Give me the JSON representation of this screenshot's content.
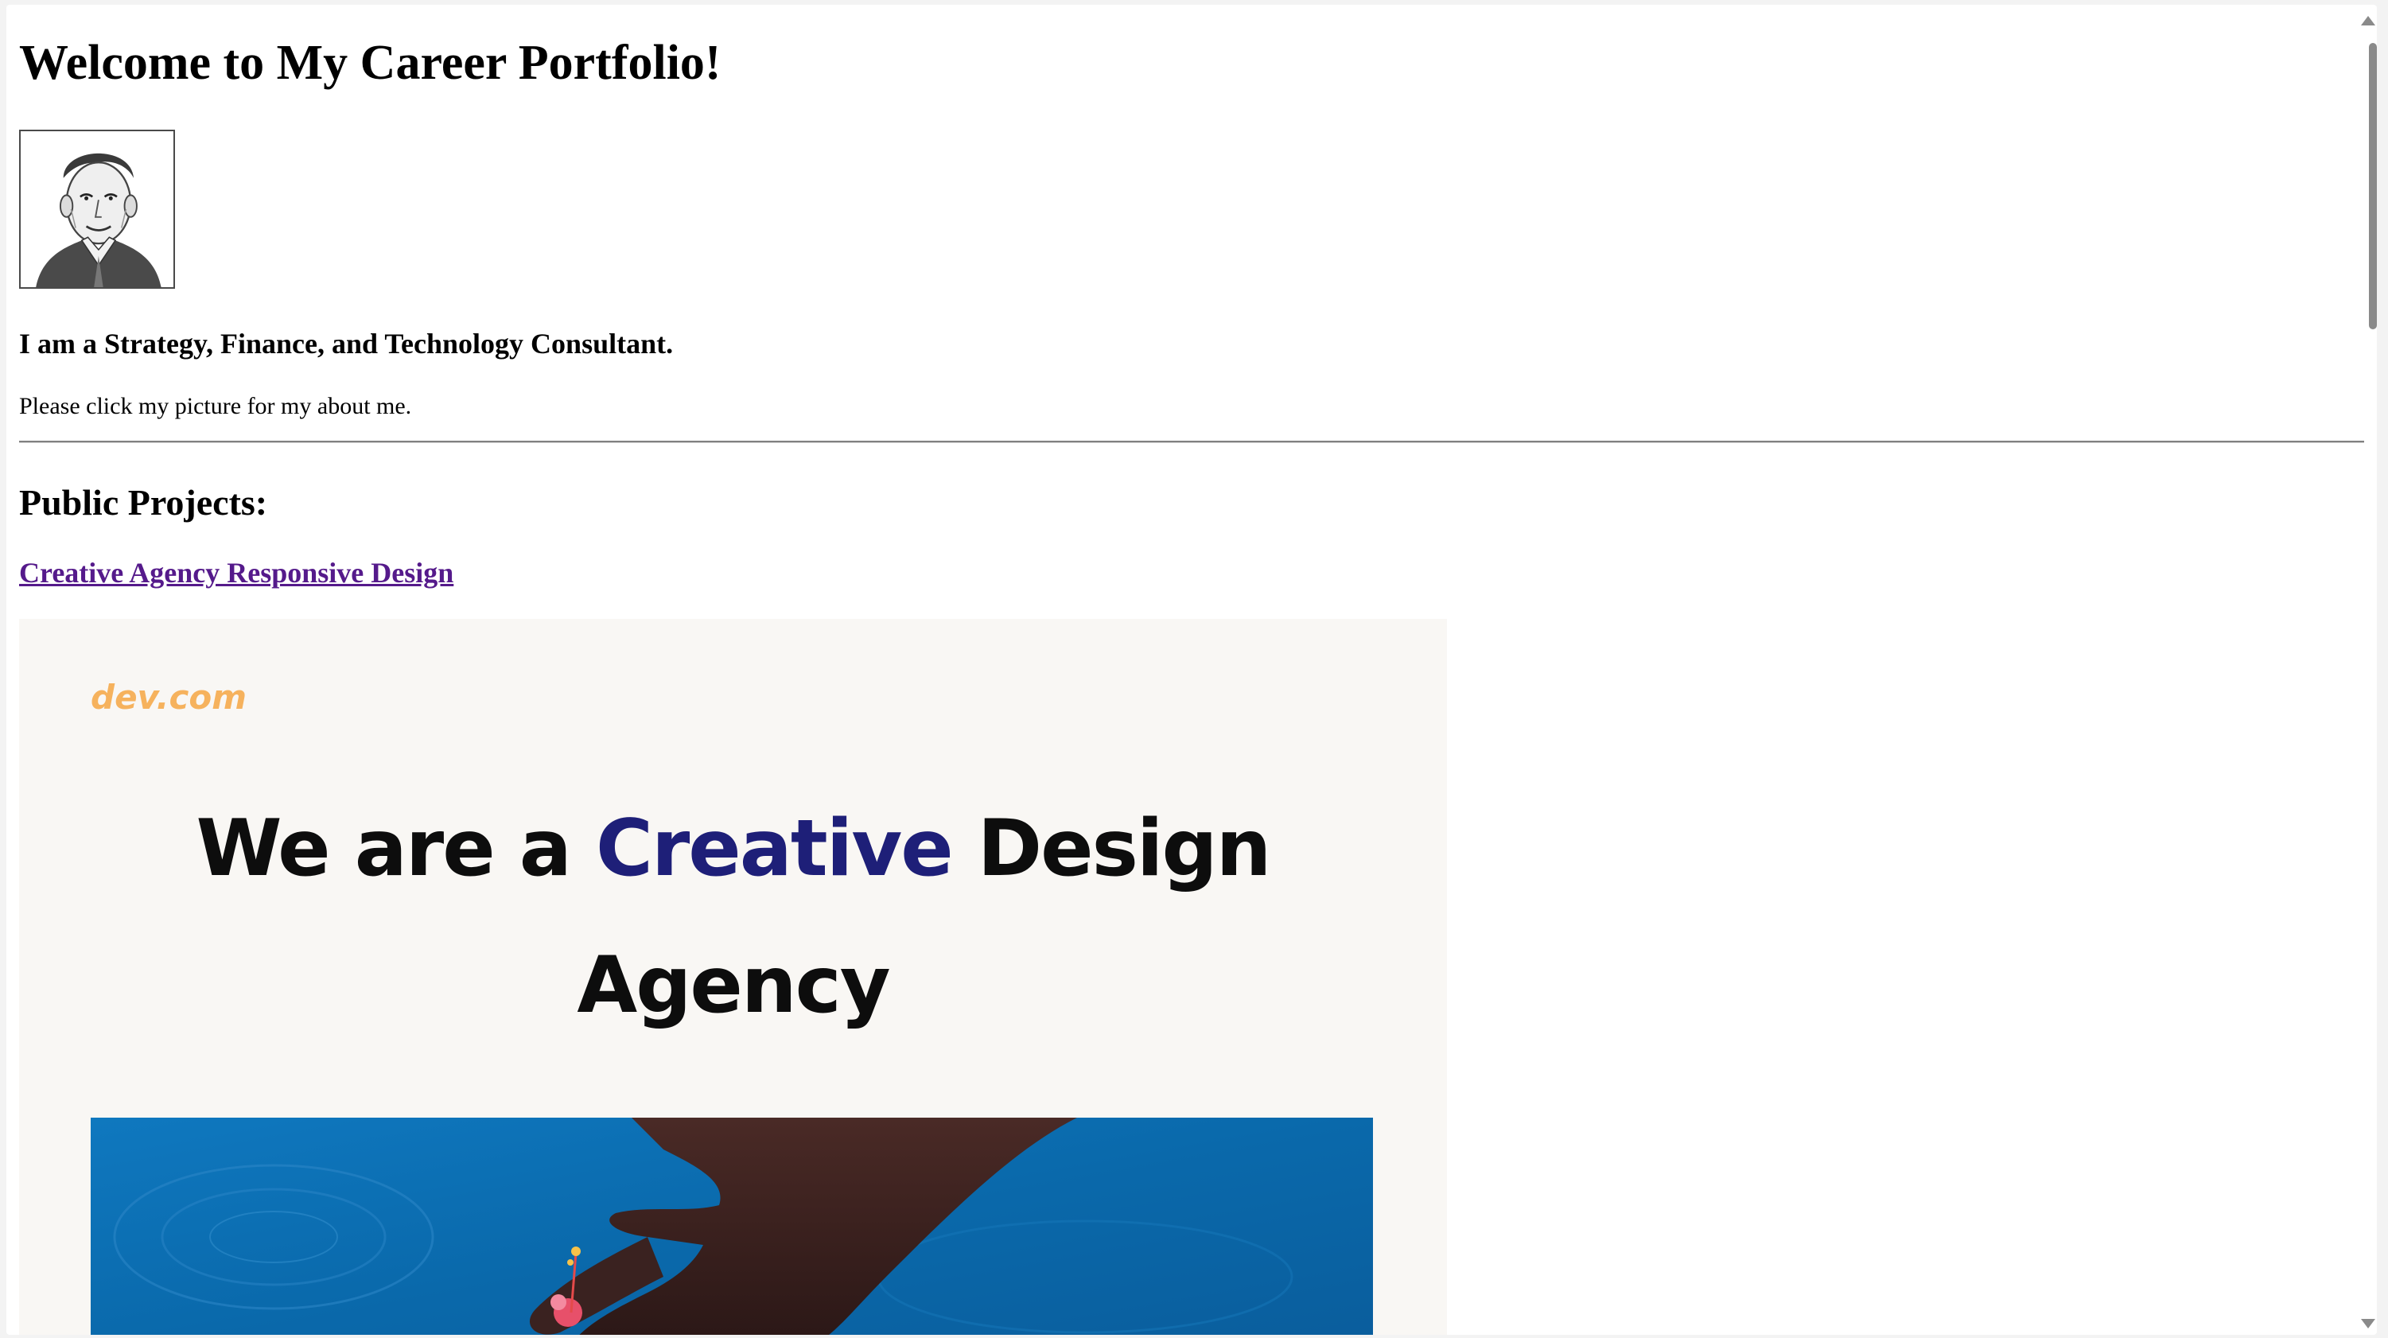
{
  "page": {
    "heading": "Welcome to My Career Portfolio!",
    "tagline": "I am a Strategy, Finance, and Technology Consultant.",
    "intro": "Please click my picture for my about me.",
    "projects_heading": "Public Projects:"
  },
  "projects": [
    {
      "title": "Creative Agency Responsive Design",
      "preview": {
        "logo": "dev.com",
        "hero_line1_before": "We are a ",
        "hero_line1_accent": "Creative",
        "hero_line1_after": " Design",
        "hero_line2": "Agency"
      }
    }
  ],
  "colors": {
    "link_visited": "#551a8b",
    "preview_logo": "#f6b25d",
    "preview_accent": "#1e1f78",
    "preview_photo_water": "#0a6aad"
  },
  "icons": {
    "avatar": "portrait-sketch",
    "scroll_up": "triangle-up-icon",
    "scroll_down": "triangle-down-icon"
  }
}
